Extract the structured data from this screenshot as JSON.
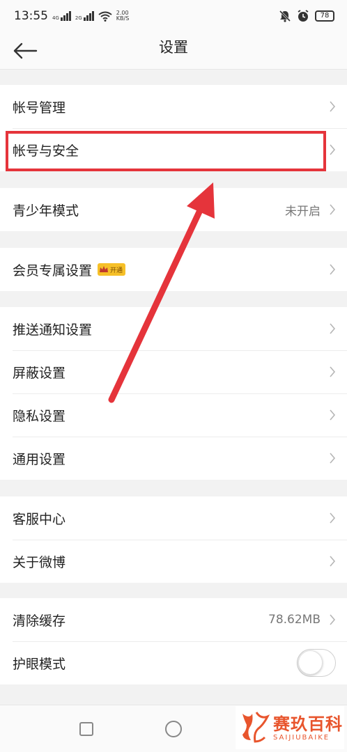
{
  "status_bar": {
    "time": "13:55",
    "sim1": "4G",
    "sim2": "2G",
    "speed_value": "2.00",
    "speed_unit": "KB/S",
    "battery": "78"
  },
  "header": {
    "title": "设置"
  },
  "groups": [
    {
      "items": [
        {
          "label": "帐号管理"
        },
        {
          "label": "帐号与安全"
        }
      ]
    },
    {
      "items": [
        {
          "label": "青少年模式",
          "value": "未开启"
        }
      ]
    },
    {
      "items": [
        {
          "label": "会员专属设置",
          "badge": "开通"
        }
      ]
    },
    {
      "items": [
        {
          "label": "推送通知设置"
        },
        {
          "label": "屏蔽设置"
        },
        {
          "label": "隐私设置"
        },
        {
          "label": "通用设置"
        }
      ]
    },
    {
      "items": [
        {
          "label": "客服中心"
        },
        {
          "label": "关于微博"
        }
      ]
    },
    {
      "items": [
        {
          "label": "清除缓存",
          "value": "78.62MB"
        },
        {
          "label": "护眼模式",
          "toggle": false
        }
      ]
    }
  ],
  "watermark": {
    "main": "赛玖百科",
    "sub": "SAIJIUBAIKE"
  },
  "colors": {
    "annotation_red": "#e5343b",
    "badge_gold": "#f6c028",
    "watermark_orange": "#e8552d"
  }
}
